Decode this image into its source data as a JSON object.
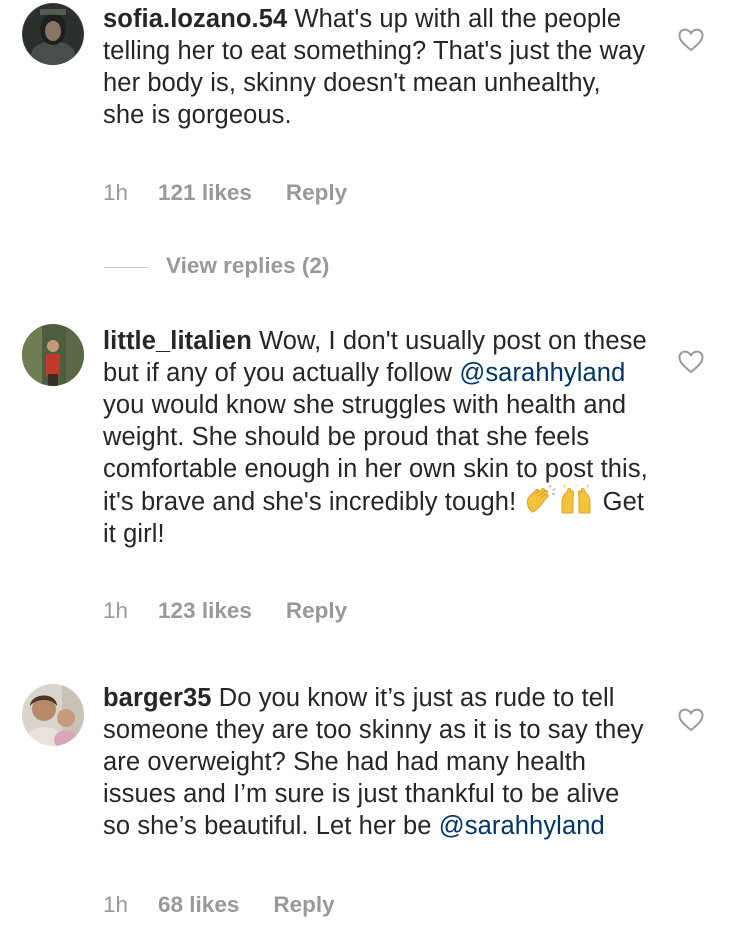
{
  "comments": [
    {
      "username": "sofia.lozano.54",
      "text": "What's up with all the people telling her to eat something? That's just the way her body is, skinny doesn't mean unhealthy, she is gorgeous.",
      "time": "1h",
      "likes": "121 likes",
      "reply": "Reply",
      "view_replies": "View replies (2)"
    },
    {
      "username": "little_litalien",
      "text_1": "Wow, I don't usually post on these but if any of you actually follow",
      "mention": "@sarahhyland",
      "text_2": "you would know she struggles with health and weight. She should be proud that she feels comfortable enough in her own skin to post this, it's brave and she's incredibly tough!",
      "emoji_1": "clapping-hands-emoji",
      "emoji_2": "raising-hands-emoji",
      "text_3": "Get it girl!",
      "time": "1h",
      "likes": "123 likes",
      "reply": "Reply"
    },
    {
      "username": "barger35",
      "text_1": "Do you know it’s just as rude to tell someone they are too skinny as it is to say they are overweight? She had had many health issues and I’m sure is just thankful to be alive so she’s beautiful. Let her be",
      "mention": "@sarahhyland",
      "time": "1h",
      "likes": "68 likes",
      "reply": "Reply"
    }
  ],
  "colors": {
    "text": "#262626",
    "secondary": "#999999",
    "mention": "#003569"
  },
  "icons": {
    "like": "heart-outline-icon"
  }
}
